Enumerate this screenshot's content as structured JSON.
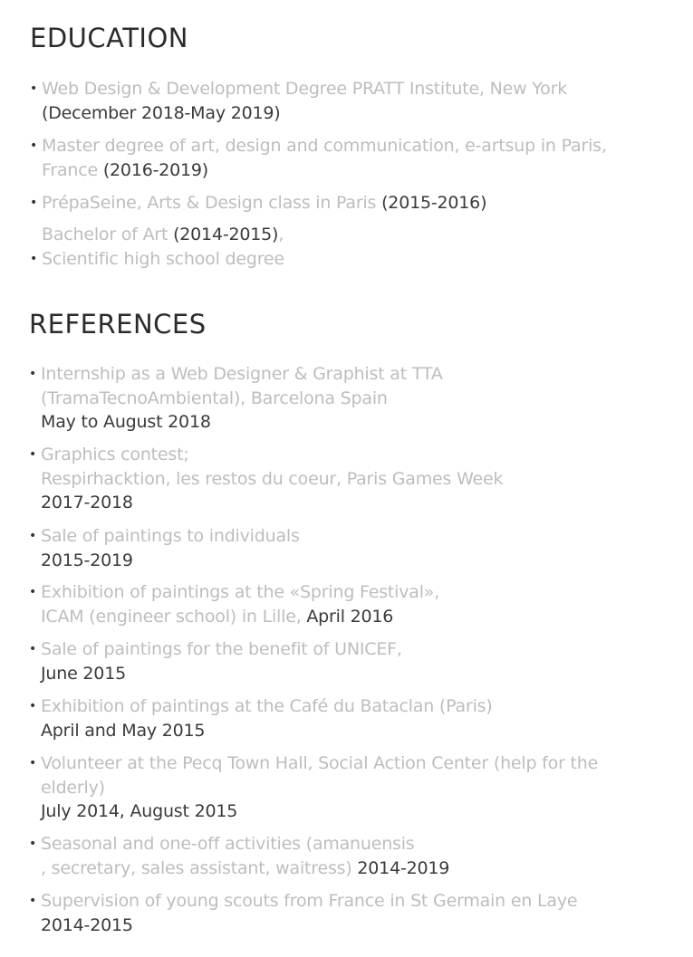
{
  "education": {
    "heading": "EDUCATION",
    "items": [
      {
        "l1": "Web Design & Development Degree PRATT Institute, New York",
        "l2_dark": "(December 2018-May 2019)"
      },
      {
        "l1": "Master degree of art, design and communication, e-artsup in Paris,",
        "l2_light": "France ",
        "l2_dark": "(2016-2019)"
      },
      {
        "l1": "PrépaSeine,  Arts & Design class in Paris ",
        "l1_dark": "(2015-2016)"
      },
      {
        "l1": "Bachelor of Art ",
        "l1_dark": "(2014-2015)",
        "l1_tail": ","
      },
      {
        "l1": "Scientific high school degree"
      }
    ]
  },
  "references": {
    "heading": "REFERENCES",
    "items": [
      {
        "l1": "Internship as a Web Designer & Graphist at TTA",
        "l2_light": "(TramaTecnoAmbiental), Barcelona Spain",
        "l3_dark": "May to August 2018"
      },
      {
        "l1": "Graphics contest;",
        "l2_light": "Respirhacktion, les restos du coeur, Paris Games Week",
        "l3_dark": "2017-2018"
      },
      {
        "l1": "Sale of paintings to individuals",
        "l2_dark": "2015-2019"
      },
      {
        "l1": "Exhibition of paintings at the «Spring Festival»,",
        "l2_light": "ICAM (engineer school) in Lille, ",
        "l2_dark": "April 2016"
      },
      {
        "l1": "Sale of paintings for the benefit of UNICEF,",
        "l2_dark": "June 2015"
      },
      {
        "l1": "Exhibition of paintings at the Café du Bataclan (Paris)",
        "l2_dark": "April and May 2015"
      },
      {
        "l1": "Volunteer at the Pecq Town Hall, Social Action Center (help for the",
        "l2_light": "elderly)",
        "l3_dark": "July 2014, August 2015"
      },
      {
        "l1": "Seasonal and one-off activities (amanuensis",
        "l2_light": ", secretary, sales assistant, waitress) ",
        "l2_dark": "2014-2019"
      },
      {
        "l1": "Supervision of young scouts from France in St Germain en Laye",
        "l2_dark": "2014-2015"
      }
    ]
  },
  "bullet": "•"
}
